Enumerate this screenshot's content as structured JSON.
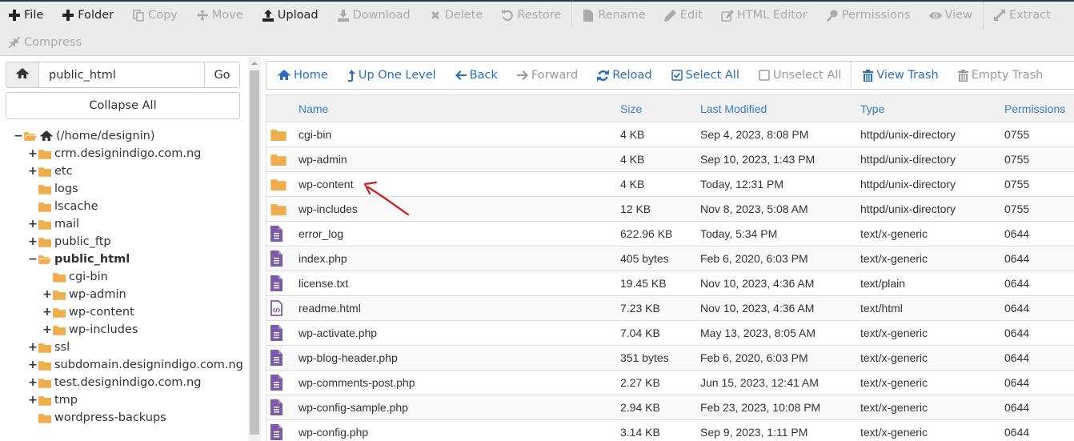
{
  "toolbar": {
    "row1": [
      {
        "id": "file",
        "label": "File",
        "icon": "plus-icon",
        "enabled": true
      },
      {
        "id": "folder",
        "label": "Folder",
        "icon": "plus-icon",
        "enabled": true
      },
      {
        "id": "copy",
        "label": "Copy",
        "icon": "copy-icon",
        "enabled": false
      },
      {
        "id": "move",
        "label": "Move",
        "icon": "move-icon",
        "enabled": false
      },
      {
        "id": "upload",
        "label": "Upload",
        "icon": "upload-icon",
        "enabled": true
      },
      {
        "id": "download",
        "label": "Download",
        "icon": "download-icon",
        "enabled": false
      },
      {
        "id": "delete",
        "label": "Delete",
        "icon": "times-icon",
        "enabled": false
      },
      {
        "id": "restore",
        "label": "Restore",
        "icon": "undo-icon",
        "enabled": false
      },
      {
        "id": "rename",
        "label": "Rename",
        "icon": "file-icon",
        "enabled": false
      },
      {
        "id": "edit",
        "label": "Edit",
        "icon": "pencil-icon",
        "enabled": false
      },
      {
        "id": "html-editor",
        "label": "HTML Editor",
        "icon": "edit-square-icon",
        "enabled": false
      },
      {
        "id": "permissions",
        "label": "Permissions",
        "icon": "key-icon",
        "enabled": false
      },
      {
        "id": "view",
        "label": "View",
        "icon": "eye-icon",
        "enabled": false
      },
      {
        "id": "extract",
        "label": "Extract",
        "icon": "expand-icon",
        "enabled": false
      }
    ],
    "row2": [
      {
        "id": "compress",
        "label": "Compress",
        "icon": "compress-icon",
        "enabled": false
      }
    ]
  },
  "sidebar": {
    "path_value": "public_html",
    "go_label": "Go",
    "collapse_label": "Collapse All",
    "tree": [
      {
        "label": "(/home/designin)",
        "depth": 0,
        "toggle": "−",
        "open": true,
        "home": true
      },
      {
        "label": "crm.designindigo.com.ng",
        "depth": 1,
        "toggle": "+"
      },
      {
        "label": "etc",
        "depth": 1,
        "toggle": "+"
      },
      {
        "label": "logs",
        "depth": 1,
        "toggle": ""
      },
      {
        "label": "lscache",
        "depth": 1,
        "toggle": ""
      },
      {
        "label": "mail",
        "depth": 1,
        "toggle": "+"
      },
      {
        "label": "public_ftp",
        "depth": 1,
        "toggle": "+"
      },
      {
        "label": "public_html",
        "depth": 1,
        "toggle": "−",
        "open": true,
        "bold": true
      },
      {
        "label": "cgi-bin",
        "depth": 2,
        "toggle": ""
      },
      {
        "label": "wp-admin",
        "depth": 2,
        "toggle": "+"
      },
      {
        "label": "wp-content",
        "depth": 2,
        "toggle": "+"
      },
      {
        "label": "wp-includes",
        "depth": 2,
        "toggle": "+"
      },
      {
        "label": "ssl",
        "depth": 1,
        "toggle": "+"
      },
      {
        "label": "subdomain.designindigo.com.ng",
        "depth": 1,
        "toggle": "+"
      },
      {
        "label": "test.designindigo.com.ng",
        "depth": 1,
        "toggle": "+"
      },
      {
        "label": "tmp",
        "depth": 1,
        "toggle": "+"
      },
      {
        "label": "wordpress-backups",
        "depth": 1,
        "toggle": ""
      }
    ]
  },
  "nav": {
    "buttons": [
      {
        "id": "home",
        "label": "Home",
        "icon": "home-icon",
        "enabled": true
      },
      {
        "id": "up",
        "label": "Up One Level",
        "icon": "level-up-icon",
        "enabled": true
      },
      {
        "id": "back",
        "label": "Back",
        "icon": "arrow-left-icon",
        "enabled": true
      },
      {
        "id": "forward",
        "label": "Forward",
        "icon": "arrow-right-icon",
        "enabled": false
      },
      {
        "id": "reload",
        "label": "Reload",
        "icon": "refresh-icon",
        "enabled": true
      },
      {
        "id": "select-all",
        "label": "Select All",
        "icon": "checkbox-checked-icon",
        "enabled": true
      },
      {
        "id": "unselect-all",
        "label": "Unselect All",
        "icon": "checkbox-empty-icon",
        "enabled": false
      },
      {
        "id": "view-trash",
        "label": "View Trash",
        "icon": "trash-icon",
        "enabled": true,
        "sep_before": true
      },
      {
        "id": "empty-trash",
        "label": "Empty Trash",
        "icon": "trash-icon",
        "enabled": false
      }
    ]
  },
  "table": {
    "columns": [
      "Name",
      "Size",
      "Last Modified",
      "Type",
      "Permissions"
    ],
    "rows": [
      {
        "icon": "folder",
        "name": "cgi-bin",
        "size": "4 KB",
        "modified": "Sep 4, 2023, 8:08 PM",
        "type": "httpd/unix-directory",
        "perms": "0755"
      },
      {
        "icon": "folder",
        "name": "wp-admin",
        "size": "4 KB",
        "modified": "Sep 10, 2023, 1:43 PM",
        "type": "httpd/unix-directory",
        "perms": "0755"
      },
      {
        "icon": "folder",
        "name": "wp-content",
        "size": "4 KB",
        "modified": "Today, 12:31 PM",
        "type": "httpd/unix-directory",
        "perms": "0755"
      },
      {
        "icon": "folder",
        "name": "wp-includes",
        "size": "12 KB",
        "modified": "Nov 8, 2023, 5:08 AM",
        "type": "httpd/unix-directory",
        "perms": "0755"
      },
      {
        "icon": "file",
        "name": "error_log",
        "size": "622.96 KB",
        "modified": "Today, 5:34 PM",
        "type": "text/x-generic",
        "perms": "0644"
      },
      {
        "icon": "file",
        "name": "index.php",
        "size": "405 bytes",
        "modified": "Feb 6, 2020, 6:03 PM",
        "type": "text/x-generic",
        "perms": "0644"
      },
      {
        "icon": "file",
        "name": "license.txt",
        "size": "19.45 KB",
        "modified": "Nov 10, 2023, 4:36 AM",
        "type": "text/plain",
        "perms": "0644"
      },
      {
        "icon": "code",
        "name": "readme.html",
        "size": "7.23 KB",
        "modified": "Nov 10, 2023, 4:36 AM",
        "type": "text/html",
        "perms": "0644"
      },
      {
        "icon": "file",
        "name": "wp-activate.php",
        "size": "7.04 KB",
        "modified": "May 13, 2023, 8:05 AM",
        "type": "text/x-generic",
        "perms": "0644"
      },
      {
        "icon": "file",
        "name": "wp-blog-header.php",
        "size": "351 bytes",
        "modified": "Feb 6, 2020, 6:03 PM",
        "type": "text/x-generic",
        "perms": "0644"
      },
      {
        "icon": "file",
        "name": "wp-comments-post.php",
        "size": "2.27 KB",
        "modified": "Jun 15, 2023, 12:41 AM",
        "type": "text/x-generic",
        "perms": "0644"
      },
      {
        "icon": "file",
        "name": "wp-config-sample.php",
        "size": "2.94 KB",
        "modified": "Feb 23, 2023, 10:08 PM",
        "type": "text/x-generic",
        "perms": "0644"
      },
      {
        "icon": "file",
        "name": "wp-config.php",
        "size": "3.14 KB",
        "modified": "Sep 9, 2023, 1:11 PM",
        "type": "text/x-generic",
        "perms": "0644"
      }
    ]
  },
  "colors": {
    "folder": "#f0ad4e",
    "file": "#7b5aa6",
    "link": "#2a6ebb",
    "annotation": "#d11a1a"
  }
}
